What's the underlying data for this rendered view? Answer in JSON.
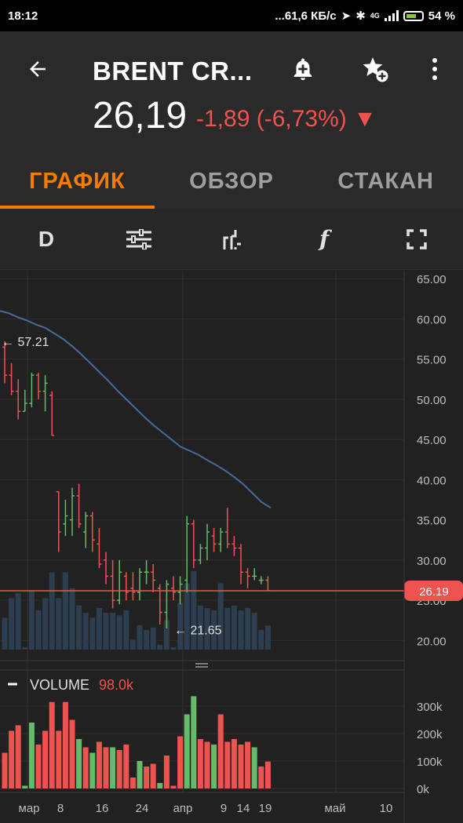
{
  "status_bar": {
    "time": "18:12",
    "network": "...61,6 КБ/с",
    "network_type": "4G",
    "battery": "54 %"
  },
  "header": {
    "title": "BRENT CR...",
    "price": "26,19",
    "change": "-1,89 (-6,73%) ▼",
    "colors": {
      "negative": "#ef5350",
      "accent": "#f57c00"
    }
  },
  "tabs": [
    {
      "label": "ГРАФИК",
      "active": true
    },
    {
      "label": "ОБЗОР",
      "active": false
    },
    {
      "label": "СТАКАН",
      "active": false
    }
  ],
  "toolbar": {
    "interval_label": "D",
    "settings_icon": "sliders-icon",
    "chart_type_icon": "bar-chart-type-icon",
    "indicators_label": "f",
    "fullscreen_icon": "fullscreen-icon"
  },
  "chart_data": [
    {
      "type": "ohlc",
      "price_ticks": [
        "65.00",
        "60.00",
        "55.00",
        "50.00",
        "45.00",
        "40.00",
        "35.00",
        "30.00",
        "25.00",
        "20.00"
      ],
      "ylim": [
        17.5,
        66
      ],
      "current_price_label": "26.19",
      "current_price": 26.19,
      "max_annotation": "← 57.21",
      "max_value": 57.21,
      "min_annotation": "← 21.65",
      "min_value": 21.65,
      "colors": {
        "up": "#66bb6a",
        "down": "#ef5350",
        "ma": "#4a6a9a"
      },
      "bars": [
        [
          56.5,
          57.2,
          52.0,
          53.0
        ],
        [
          53,
          54.5,
          50.5,
          51
        ],
        [
          51,
          52.5,
          47.5,
          48.5
        ],
        [
          48.5,
          51.2,
          48.5,
          49.5
        ],
        [
          49.5,
          53.3,
          49,
          53
        ],
        [
          53,
          53.3,
          50,
          51
        ],
        [
          51,
          53,
          48.5,
          52
        ],
        [
          50.5,
          51,
          45.5,
          45.5
        ],
        [
          38.5,
          38.5,
          31,
          33.5
        ],
        [
          34.5,
          37.5,
          33,
          35.5
        ],
        [
          35,
          39,
          33,
          38
        ],
        [
          38,
          39.5,
          34,
          34.5
        ],
        [
          33.5,
          36,
          31.5,
          35.5
        ],
        [
          35.5,
          36,
          31,
          32.5
        ],
        [
          32,
          34,
          29,
          29.5
        ],
        [
          30,
          31,
          27,
          28
        ],
        [
          28,
          30,
          24,
          25
        ],
        [
          25,
          30,
          24.5,
          28.5
        ],
        [
          28,
          28.5,
          25,
          26
        ],
        [
          26.5,
          28.5,
          25,
          26
        ],
        [
          26,
          29,
          25,
          28.5
        ],
        [
          28.5,
          30,
          27,
          28.5
        ],
        [
          28.5,
          29.5,
          26,
          27.5
        ],
        [
          26.5,
          27,
          22,
          23.5
        ],
        [
          23.5,
          27.5,
          21.5,
          27
        ],
        [
          26.5,
          28,
          25,
          26
        ],
        [
          26,
          28,
          24.5,
          27
        ],
        [
          27.5,
          35.5,
          26,
          34.5
        ],
        [
          34.5,
          35,
          29,
          30
        ],
        [
          30,
          32,
          29.5,
          31.5
        ],
        [
          31.5,
          34.5,
          30,
          33.5
        ],
        [
          33,
          34,
          31,
          32
        ],
        [
          32,
          34,
          31,
          33.5
        ],
        [
          33.5,
          36.5,
          31.5,
          32
        ],
        [
          32,
          33,
          30.5,
          31.5
        ],
        [
          31.5,
          32,
          27,
          28.5
        ],
        [
          28.5,
          29,
          26.5,
          28
        ],
        [
          28,
          29,
          27.5,
          28
        ],
        [
          27.5,
          28,
          27,
          27.5
        ],
        [
          27.5,
          28,
          26.2,
          26.2
        ]
      ],
      "ma": [
        61,
        60.7,
        60.2,
        59.8,
        59.3,
        58.9,
        58.2,
        57.5,
        56.6,
        55.6,
        54.5,
        53.4,
        52.3,
        51.1,
        50,
        48.9,
        47.8,
        46.8,
        45.9,
        45,
        44.1,
        43.6,
        43.1,
        42.4,
        41.8,
        41.1,
        40.3,
        39.4,
        38.3,
        37.2,
        36.5
      ],
      "ma_start_index": -4
    },
    {
      "type": "bar",
      "title": "VOLUME",
      "value_label": "98.0k",
      "volume_ticks": [
        "300k",
        "200k",
        "100k",
        "0k"
      ],
      "ylim": [
        0,
        320000
      ],
      "x_ticks": [
        "мар",
        "8",
        "16",
        "24",
        "апр",
        "9",
        "14",
        "19",
        "май",
        "10"
      ],
      "bars": [
        {
          "v": 130000,
          "up": false
        },
        {
          "v": 210000,
          "up": false
        },
        {
          "v": 230000,
          "up": false
        },
        {
          "v": 10000,
          "up": true
        },
        {
          "v": 240000,
          "up": true
        },
        {
          "v": 160000,
          "up": false
        },
        {
          "v": 210000,
          "up": false
        },
        {
          "v": 315000,
          "up": false
        },
        {
          "v": 210000,
          "up": false
        },
        {
          "v": 315000,
          "up": false
        },
        {
          "v": 250000,
          "up": false
        },
        {
          "v": 180000,
          "up": true
        },
        {
          "v": 150000,
          "up": false
        },
        {
          "v": 130000,
          "up": true
        },
        {
          "v": 170000,
          "up": false
        },
        {
          "v": 150000,
          "up": false
        },
        {
          "v": 150000,
          "up": true
        },
        {
          "v": 140000,
          "up": false
        },
        {
          "v": 160000,
          "up": false
        },
        {
          "v": 40000,
          "up": false
        },
        {
          "v": 100000,
          "up": true
        },
        {
          "v": 80000,
          "up": false
        },
        {
          "v": 90000,
          "up": false
        },
        {
          "v": 20000,
          "up": true
        },
        {
          "v": 120000,
          "up": false
        },
        {
          "v": 10000,
          "up": false
        },
        {
          "v": 190000,
          "up": false
        },
        {
          "v": 270000,
          "up": true
        },
        {
          "v": 365000,
          "up": true
        },
        {
          "v": 180000,
          "up": false
        },
        {
          "v": 170000,
          "up": false
        },
        {
          "v": 160000,
          "up": true
        },
        {
          "v": 270000,
          "up": false
        },
        {
          "v": 170000,
          "up": false
        },
        {
          "v": 180000,
          "up": false
        },
        {
          "v": 160000,
          "up": false
        },
        {
          "v": 170000,
          "up": false
        },
        {
          "v": 150000,
          "up": true
        },
        {
          "v": 80000,
          "up": false
        },
        {
          "v": 98000,
          "up": false
        }
      ]
    }
  ]
}
